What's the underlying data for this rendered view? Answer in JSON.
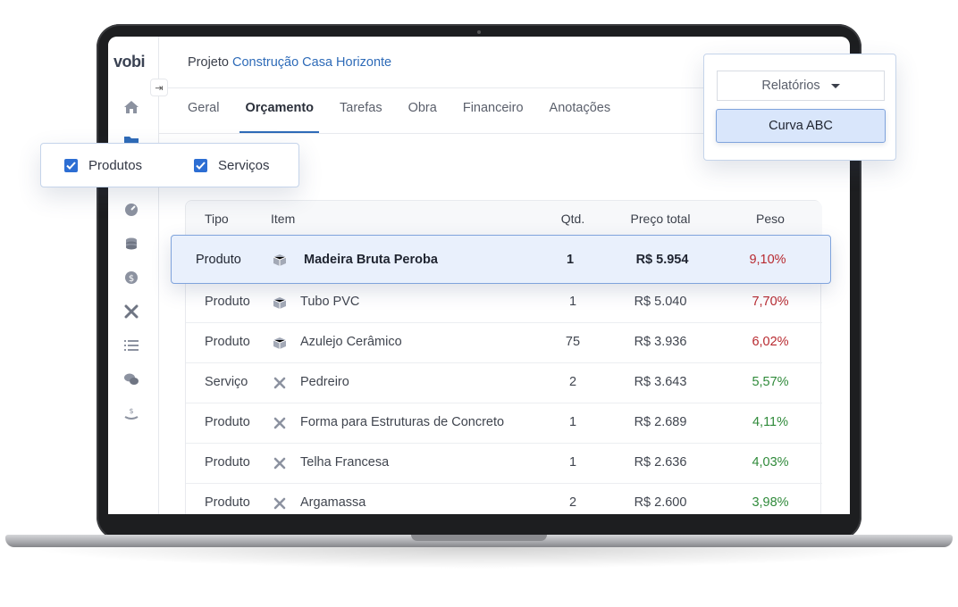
{
  "app": {
    "logo": "vobi"
  },
  "header": {
    "project_prefix": "Projeto",
    "project_name": "Construção Casa Horizonte"
  },
  "sidebar": {
    "collapse_icon": "arrow-right-icon",
    "icons": [
      "home-icon",
      "folder-icon",
      "gauge-icon",
      "coins-stack-icon",
      "dollar-icon",
      "tools-icon",
      "list-icon",
      "chat-icon",
      "hand-money-icon"
    ]
  },
  "tabs": [
    {
      "label": "Geral",
      "active": false
    },
    {
      "label": "Orçamento",
      "active": true
    },
    {
      "label": "Tarefas",
      "active": false
    },
    {
      "label": "Obra",
      "active": false
    },
    {
      "label": "Financeiro",
      "active": false
    },
    {
      "label": "Anotações",
      "active": false
    }
  ],
  "filters": [
    {
      "label": "Produtos",
      "checked": true
    },
    {
      "label": "Serviços",
      "checked": true
    }
  ],
  "reports": {
    "dropdown_label": "Relatórios",
    "selected_report": "Curva ABC"
  },
  "table": {
    "columns": [
      "Tipo",
      "Item",
      "Qtd.",
      "Preço total",
      "Peso"
    ],
    "highlighted": {
      "tipo": "Produto",
      "icon": "box-icon",
      "item": "Madeira Bruta Peroba",
      "qtd": "1",
      "preco": "R$ 5.954",
      "peso": "9,10%",
      "peso_color": "red"
    },
    "rows": [
      {
        "tipo": "Produto",
        "icon": "box-icon",
        "item": "Tubo PVC",
        "qtd": "1",
        "preco": "R$ 5.040",
        "peso": "7,70%",
        "peso_color": "red"
      },
      {
        "tipo": "Produto",
        "icon": "box-icon",
        "item": "Azulejo Cerâmico",
        "qtd": "75",
        "preco": "R$ 3.936",
        "peso": "6,02%",
        "peso_color": "red"
      },
      {
        "tipo": "Serviço",
        "icon": "tools-icon",
        "item": "Pedreiro",
        "qtd": "2",
        "preco": "R$ 3.643",
        "peso": "5,57%",
        "peso_color": "green"
      },
      {
        "tipo": "Produto",
        "icon": "tools-icon",
        "item": "Forma para Estruturas de Concreto",
        "qtd": "1",
        "preco": "R$ 2.689",
        "peso": "4,11%",
        "peso_color": "green"
      },
      {
        "tipo": "Produto",
        "icon": "tools-icon",
        "item": "Telha Francesa",
        "qtd": "1",
        "preco": "R$ 2.636",
        "peso": "4,03%",
        "peso_color": "green"
      },
      {
        "tipo": "Produto",
        "icon": "tools-icon",
        "item": "Argamassa",
        "qtd": "2",
        "preco": "R$ 2.600",
        "peso": "3,98%",
        "peso_color": "green"
      }
    ]
  },
  "colors": {
    "accent": "#2e6bb8",
    "checkbox": "#2d6ed3",
    "weight_high": "#b8292f",
    "weight_low": "#2f8a3a"
  }
}
